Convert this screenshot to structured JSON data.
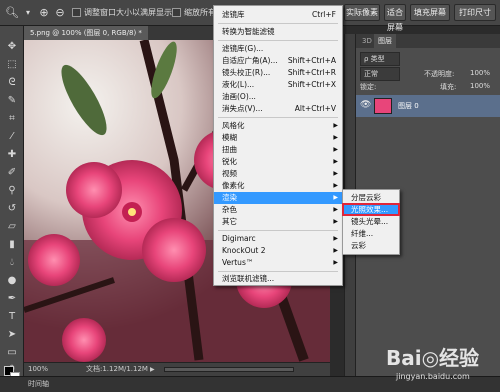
{
  "options_bar": {
    "check_resize_label": "调整窗口大小以满屏显示",
    "check_zoom_all_label": "缩放所有窗口",
    "btn_actual": "实际像素",
    "btn_fit": "适合屏幕",
    "btn_fill": "填充屏幕",
    "btn_print": "打印尺寸"
  },
  "document": {
    "tab_title": "5.png @ 100% (图层 0, RGB/8) *",
    "zoom": "100%",
    "doc_info": "文档:1.12M/1.12M"
  },
  "bottom": {
    "timeline_label": "时间轴"
  },
  "panels": {
    "tabs": [
      "3D",
      "图层"
    ],
    "kind_label": "ρ 类型",
    "blend_mode": "正常",
    "opacity_label": "不透明度:",
    "opacity_value": "100%",
    "fill_label": "填充:",
    "fill_value": "100%",
    "lock_label": "锁定:",
    "layer_name": "图层 0"
  },
  "filter_menu": {
    "items": [
      {
        "label": "滤镜库",
        "shortcut": "Ctrl+F"
      },
      {
        "label": "转换为智能滤镜",
        "shortcut": ""
      },
      {
        "label": "滤镜库(G)...",
        "shortcut": ""
      },
      {
        "label": "自适应广角(A)...",
        "shortcut": "Shift+Ctrl+A"
      },
      {
        "label": "镜头校正(R)...",
        "shortcut": "Shift+Ctrl+R"
      },
      {
        "label": "液化(L)...",
        "shortcut": "Shift+Ctrl+X"
      },
      {
        "label": "油画(O)...",
        "shortcut": ""
      },
      {
        "label": "消失点(V)...",
        "shortcut": "Alt+Ctrl+V"
      },
      {
        "label": "风格化",
        "shortcut": ""
      },
      {
        "label": "模糊",
        "shortcut": ""
      },
      {
        "label": "扭曲",
        "shortcut": ""
      },
      {
        "label": "锐化",
        "shortcut": ""
      },
      {
        "label": "视频",
        "shortcut": ""
      },
      {
        "label": "像素化",
        "shortcut": ""
      },
      {
        "label": "渲染",
        "shortcut": ""
      },
      {
        "label": "杂色",
        "shortcut": ""
      },
      {
        "label": "其它",
        "shortcut": ""
      },
      {
        "label": "Digimarc",
        "shortcut": ""
      },
      {
        "label": "KnockOut 2",
        "shortcut": ""
      },
      {
        "label": "Vertus™",
        "shortcut": ""
      },
      {
        "label": "浏览联机滤镜...",
        "shortcut": ""
      }
    ]
  },
  "render_submenu": {
    "items": [
      "分层云彩",
      "光照效果...",
      "镜头光晕...",
      "纤维...",
      "云彩"
    ]
  },
  "watermark": {
    "brand": "Bai◎经验",
    "url": "jingyan.baidu.com"
  },
  "colors": {
    "highlight": "#3399ff",
    "annotation_box": "#e0263a",
    "flower_pink": "#e8457a"
  }
}
